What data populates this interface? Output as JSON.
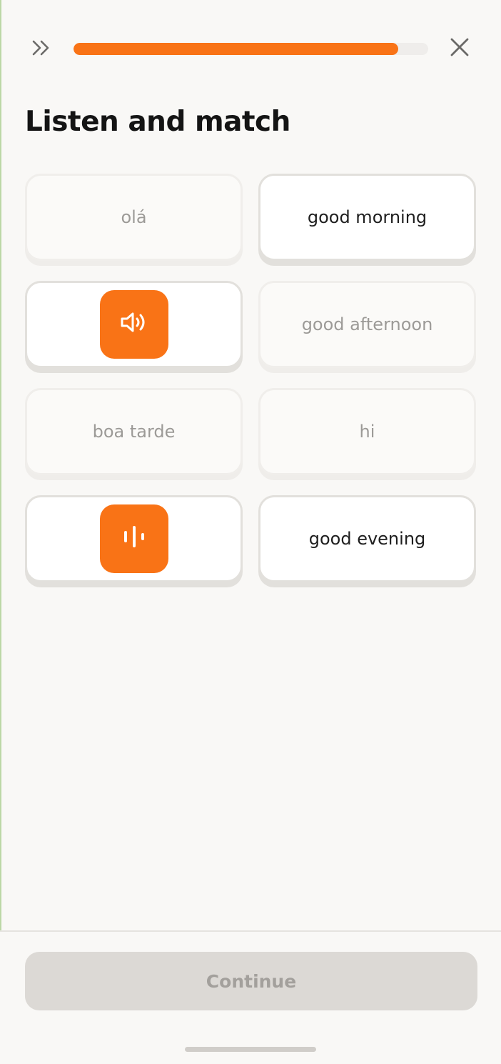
{
  "header": {
    "skip_icon": "double-chevron-right-icon",
    "progress_fraction": 0.915,
    "progress_color": "#f97316",
    "close_icon": "close-icon"
  },
  "title": "Listen and match",
  "tiles": [
    {
      "id": "ola",
      "text": "olá",
      "state": "matched"
    },
    {
      "id": "good-morning",
      "text": "good morning",
      "state": "active"
    },
    {
      "id": "audio-1",
      "icon": "speaker-icon",
      "state": "active"
    },
    {
      "id": "good-afternoon",
      "text": "good afternoon",
      "state": "matched"
    },
    {
      "id": "boa-tarde",
      "text": "boa tarde",
      "state": "matched"
    },
    {
      "id": "hi",
      "text": "hi",
      "state": "matched"
    },
    {
      "id": "audio-2",
      "icon": "audio-wave-icon",
      "state": "active"
    },
    {
      "id": "good-evening",
      "text": "good evening",
      "state": "active"
    }
  ],
  "continue_label": "Continue",
  "colors": {
    "accent": "#f97316",
    "background": "#f9f8f6",
    "button_disabled": "#dcd9d5"
  }
}
